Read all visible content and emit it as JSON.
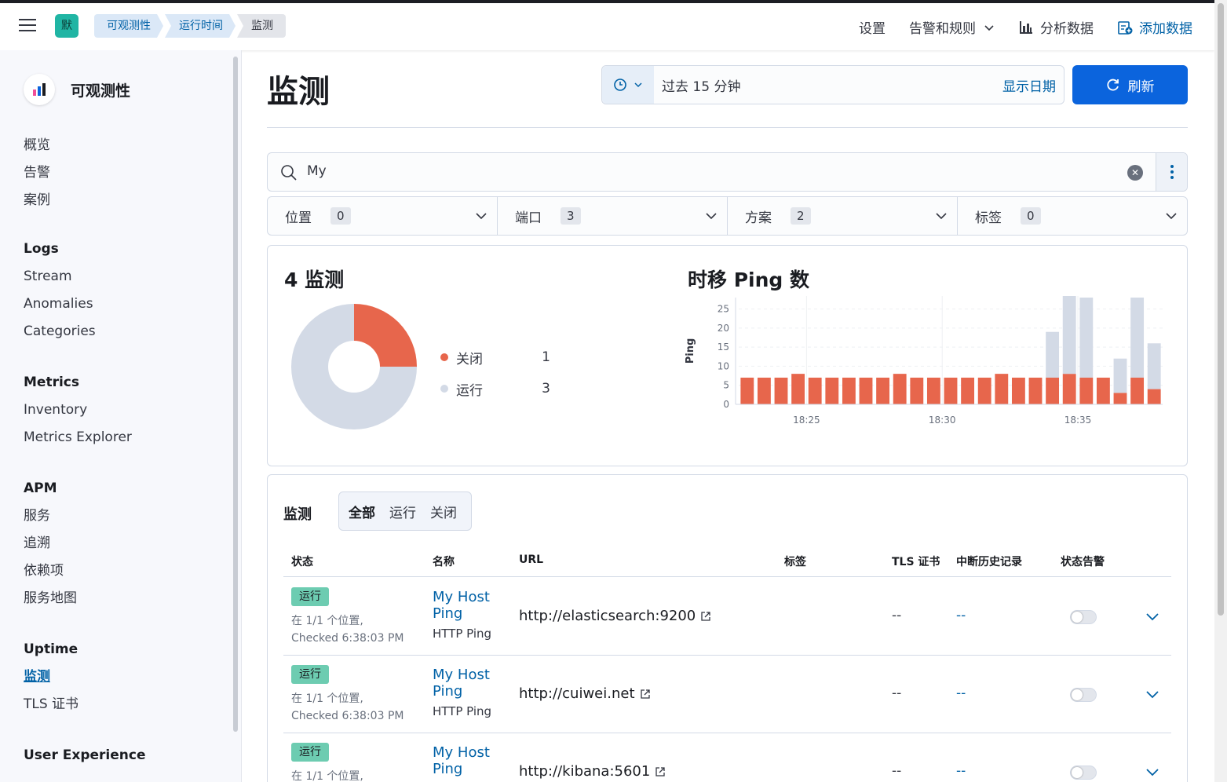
{
  "header": {
    "space_initial": "默",
    "breadcrumbs": [
      "可观测性",
      "运行时间",
      "监测"
    ],
    "links": {
      "settings": "设置",
      "alerts": "告警和规则",
      "analyze": "分析数据",
      "add_data": "添加数据"
    }
  },
  "sidebar": {
    "title": "可观测性",
    "top_items": [
      "概览",
      "告警",
      "案例"
    ],
    "groups": [
      {
        "title": "Logs",
        "items": [
          "Stream",
          "Anomalies",
          "Categories"
        ]
      },
      {
        "title": "Metrics",
        "items": [
          "Inventory",
          "Metrics Explorer"
        ]
      },
      {
        "title": "APM",
        "items": [
          "服务",
          "追溯",
          "依赖项",
          "服务地图"
        ]
      },
      {
        "title": "Uptime",
        "items": [
          "监测",
          "TLS 证书"
        ],
        "active": "监测"
      },
      {
        "title": "User Experience",
        "items": []
      }
    ]
  },
  "page": {
    "title": "监测",
    "date_range": "过去 15 分钟",
    "show_dates": "显示日期",
    "refresh": "刷新"
  },
  "search": {
    "value": "My"
  },
  "filters": [
    {
      "label": "位置",
      "count": "0"
    },
    {
      "label": "端口",
      "count": "3"
    },
    {
      "label": "方案",
      "count": "2"
    },
    {
      "label": "标签",
      "count": "0"
    }
  ],
  "summary": {
    "title": "4 监测",
    "legend": [
      {
        "label": "关闭",
        "value": "1"
      },
      {
        "label": "运行",
        "value": "3"
      }
    ]
  },
  "colors": {
    "down": "#e7664c",
    "up": "#d3dae6",
    "accent": "#0061a6",
    "primary_button": "#0b64dd",
    "badge_up": "#6dccb1"
  },
  "chart_data": {
    "type": "bar",
    "title": "时移 Ping 数",
    "ylabel": "Ping",
    "xlabel": "",
    "ylim": [
      0,
      28
    ],
    "yticks": [
      0,
      5,
      10,
      15,
      20,
      25
    ],
    "xticks": [
      {
        "index": 3,
        "label": "18:25"
      },
      {
        "index": 11,
        "label": "18:30"
      },
      {
        "index": 19,
        "label": "18:35"
      }
    ],
    "stacked": true,
    "categories": [
      "1",
      "2",
      "3",
      "4",
      "5",
      "6",
      "7",
      "8",
      "9",
      "10",
      "11",
      "12",
      "13",
      "14",
      "15",
      "16",
      "17",
      "18",
      "19",
      "20",
      "21",
      "22",
      "23",
      "24",
      "25"
    ],
    "series": [
      {
        "name": "关闭",
        "values": [
          7,
          7,
          7,
          8,
          7,
          7,
          7,
          7,
          7,
          8,
          7,
          7,
          7,
          7,
          7,
          8,
          7,
          7,
          7,
          8,
          7,
          7,
          3,
          7,
          4
        ]
      },
      {
        "name": "运行",
        "values": [
          0,
          0,
          0,
          0,
          0,
          0,
          0,
          0,
          0,
          0,
          0,
          0,
          0,
          0,
          0,
          0,
          0,
          0,
          12,
          21,
          21,
          0,
          9,
          21,
          12
        ]
      }
    ]
  },
  "monitor_table": {
    "title": "监测",
    "tabs": [
      "全部",
      "运行",
      "关闭"
    ],
    "columns": [
      "状态",
      "名称",
      "URL",
      "标签",
      "TLS 证书",
      "中断历史记录",
      "状态告警"
    ],
    "rows": [
      {
        "status": "运行",
        "loc": "在 1/1 个位置,",
        "checked": "Checked 6:38:03 PM",
        "name": "My Host Ping",
        "type": "HTTP Ping",
        "url": "http://elasticsearch:9200",
        "tls": "--",
        "history": "--"
      },
      {
        "status": "运行",
        "loc": "在 1/1 个位置,",
        "checked": "Checked 6:38:03 PM",
        "name": "My Host Ping",
        "type": "HTTP Ping",
        "url": "http://cuiwei.net",
        "tls": "--",
        "history": "--"
      },
      {
        "status": "运行",
        "loc": "在 1/1 个位置,",
        "checked": "",
        "name": "My Host Ping",
        "type": "",
        "url": "http://kibana:5601",
        "tls": "--",
        "history": "--"
      }
    ]
  }
}
